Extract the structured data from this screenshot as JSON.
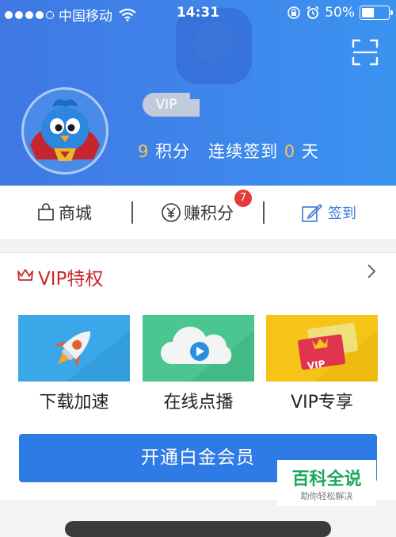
{
  "status_bar": {
    "carrier": "中国移动",
    "time": "14:31",
    "battery": "50%",
    "battery_level": 0.5
  },
  "profile": {
    "vip_label": "VIP",
    "points_value": "9",
    "points_label": "积分",
    "streak_label": "连续签到",
    "streak_value": "0",
    "streak_unit": "天"
  },
  "actions": {
    "mall_label": "商城",
    "earn_label": "赚积分",
    "earn_badge": "7",
    "checkin_label": "签到"
  },
  "vip_section": {
    "title": "VIP特权",
    "tiles": [
      {
        "label": "下载加速",
        "icon": "rocket-icon",
        "bg": "#3aa8e8"
      },
      {
        "label": "在线点播",
        "icon": "cloud-play-icon",
        "bg": "#4cc690"
      },
      {
        "label": "VIP专享",
        "icon": "vip-ticket-icon",
        "bg": "#f5c417"
      }
    ],
    "open_button": "开通白金会员"
  },
  "watermark": {
    "title": "百科全说",
    "subtitle": "助你轻松解决"
  },
  "colors": {
    "header_blue": "#3f86eb",
    "accent_orange": "#f5c35b",
    "vip_red": "#c8292b",
    "button_blue": "#2f7be6",
    "badge_red": "#e83a3a"
  }
}
